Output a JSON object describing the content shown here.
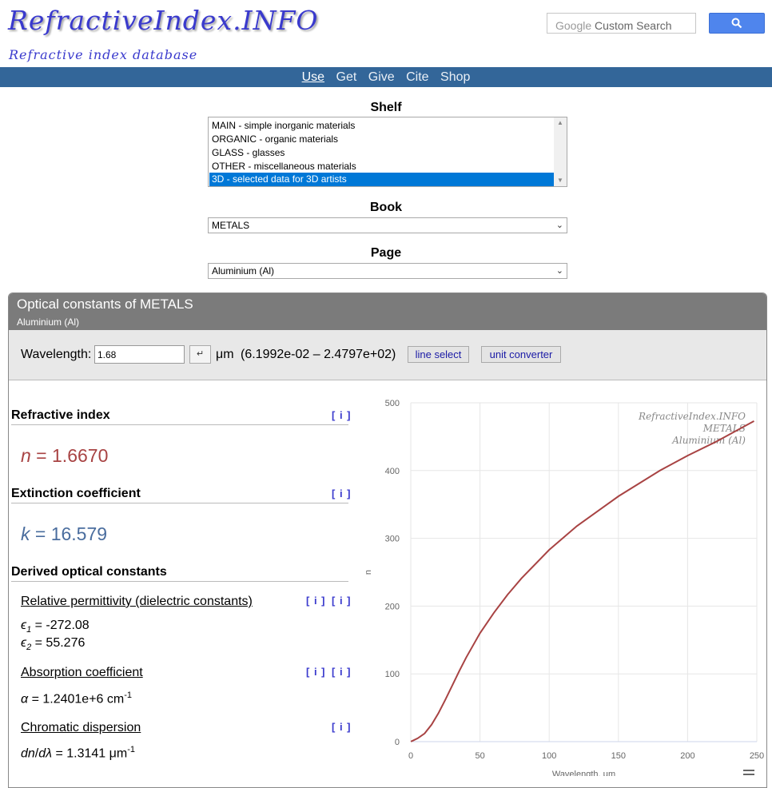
{
  "header": {
    "logo_title": "RefractiveIndex.INFO",
    "logo_subtitle": "Refractive index database",
    "search_google": "Google",
    "search_custom": " Custom Search"
  },
  "nav": [
    {
      "label": "Use",
      "active": true
    },
    {
      "label": "Get",
      "active": false
    },
    {
      "label": "Give",
      "active": false
    },
    {
      "label": "Cite",
      "active": false
    },
    {
      "label": "Shop",
      "active": false
    }
  ],
  "shelf": {
    "label": "Shelf",
    "items": [
      {
        "label": "MAIN - simple inorganic materials",
        "selected": false
      },
      {
        "label": "ORGANIC - organic materials",
        "selected": false
      },
      {
        "label": "GLASS - glasses",
        "selected": false
      },
      {
        "label": "OTHER - miscellaneous materials",
        "selected": false
      },
      {
        "label": "3D - selected data for 3D artists",
        "selected": true
      }
    ]
  },
  "book": {
    "label": "Book",
    "value": "METALS"
  },
  "page": {
    "label": "Page",
    "value": "Aluminium (Al)"
  },
  "panel": {
    "title": "Optical constants of METALS",
    "subtitle": "Aluminium (Al)",
    "wavelength_label": "Wavelength:",
    "wavelength_value": "1.68",
    "enter_symbol": "↵",
    "unit": "μm",
    "range": "(6.1992e-02 – 2.4797e+02)",
    "line_select": "line select",
    "unit_converter": "unit converter"
  },
  "results": {
    "refractive_index": {
      "title": "Refractive index",
      "info": "[ i ]",
      "symbol": "n",
      "value": " = 1.6670",
      "color": "#a84343"
    },
    "extinction": {
      "title": "Extinction coefficient",
      "info": "[ i ]",
      "symbol": "k",
      "value": " = 16.579",
      "color": "#4a6d9e"
    },
    "derived": {
      "title": "Derived optical constants",
      "permittivity": {
        "title": "Relative permittivity (dielectric constants)",
        "info": "[ i ]",
        "eps1": " = -272.08",
        "eps2": " = 55.276"
      },
      "absorption": {
        "title": "Absorption coefficient",
        "info": "[ i ]",
        "value": " = 1.2401e+6 cm",
        "exponent": "-1"
      },
      "dispersion": {
        "title": "Chromatic dispersion",
        "info": "[ i ]",
        "value": " = 1.3141 μm",
        "exponent": "-1"
      }
    }
  },
  "chart_data": {
    "type": "line",
    "xlabel": "Wavelength, μm",
    "ylabel": "n",
    "xlim": [
      0,
      250
    ],
    "ylim": [
      0,
      500
    ],
    "x_ticks": [
      0,
      50,
      100,
      150,
      200,
      250
    ],
    "y_ticks": [
      0,
      100,
      200,
      300,
      400,
      500
    ],
    "grid": true,
    "watermark": [
      "RefractiveIndex.INFO",
      "METALS",
      "Aluminium (Al)"
    ],
    "series": [
      {
        "color": "#a84343",
        "x": [
          0.06,
          2,
          5,
          10,
          15,
          20,
          25,
          30,
          35,
          40,
          50,
          60,
          70,
          80,
          100,
          120,
          150,
          180,
          200,
          220,
          248
        ],
        "y": [
          0.1,
          2,
          5,
          12,
          25,
          42,
          62,
          83,
          104,
          124,
          160,
          190,
          217,
          241,
          283,
          318,
          362,
          400,
          422,
          442,
          473
        ]
      }
    ]
  }
}
